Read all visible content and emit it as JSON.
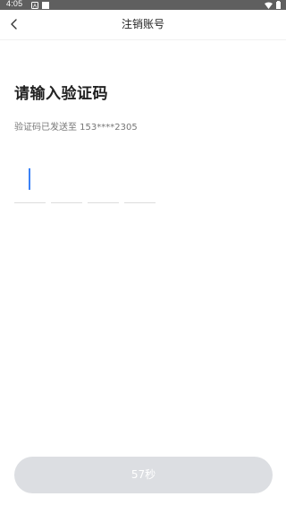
{
  "status_bar": {
    "time": "4:05",
    "icons": [
      "notification-icon",
      "sim-card-icon",
      "wifi-icon",
      "battery-icon"
    ]
  },
  "header": {
    "back_icon": "back-arrow-icon",
    "title": "注销账号"
  },
  "content": {
    "title": "请输入验证码",
    "subtitle": "验证码已发送至 153****2305"
  },
  "verification_code": {
    "digits": [
      "",
      "",
      "",
      ""
    ],
    "active_index": 0
  },
  "submit_button": {
    "label": "57秒"
  },
  "colors": {
    "status_bar": "#5f5f5f",
    "cursor": "#3b82f6",
    "button_disabled": "#dcdee2"
  }
}
